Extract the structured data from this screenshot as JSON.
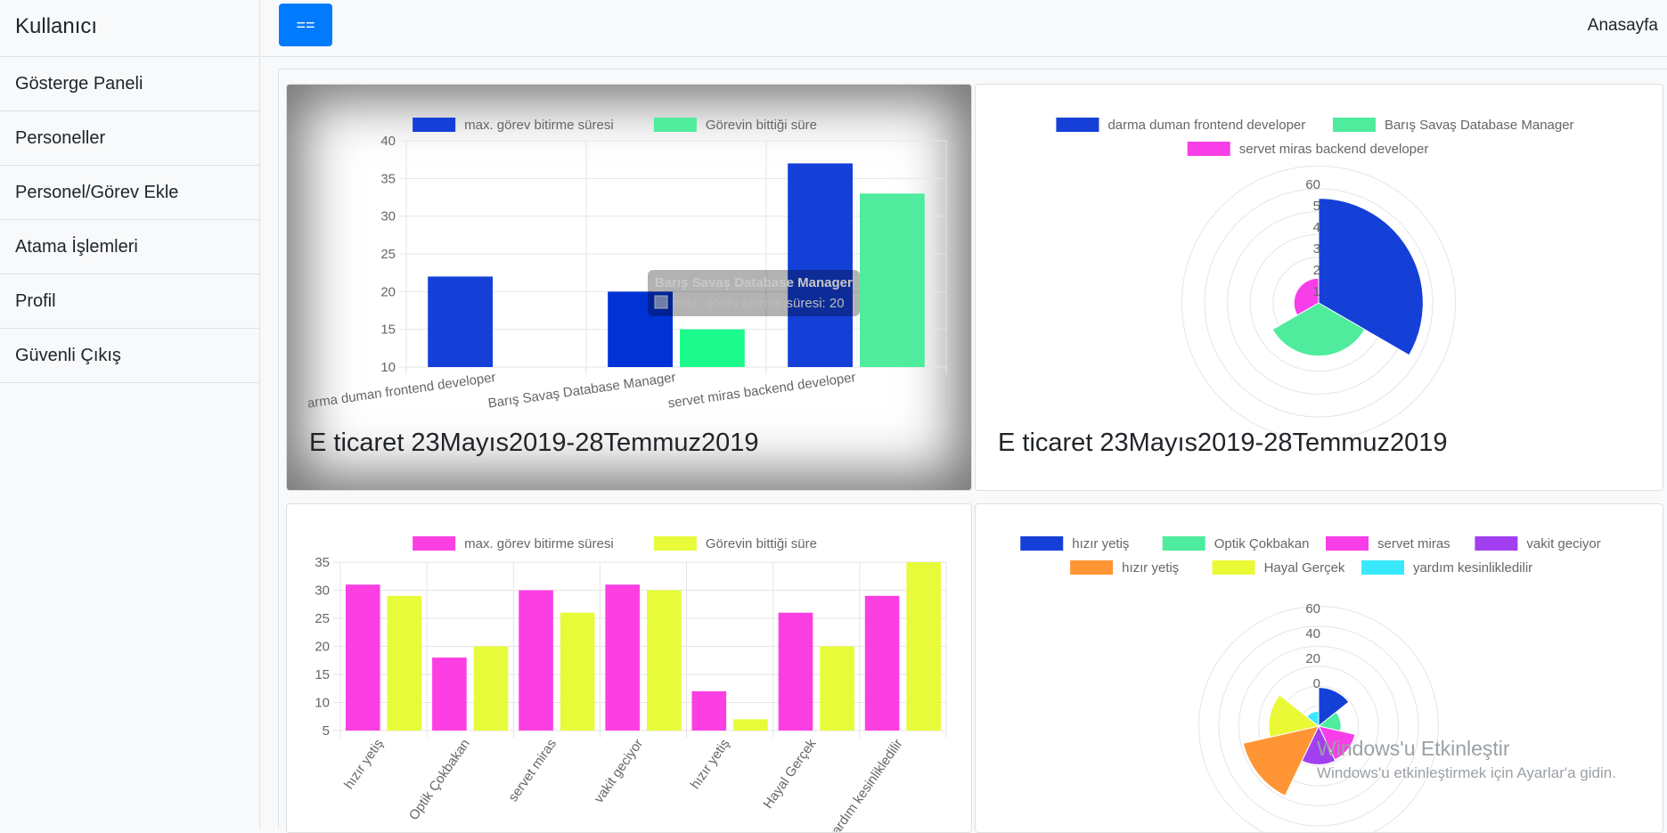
{
  "sidebar": {
    "heading": "Kullanıcı",
    "items": [
      {
        "label": "Gösterge Paneli"
      },
      {
        "label": "Personeller"
      },
      {
        "label": "Personel/Görev Ekle"
      },
      {
        "label": "Atama İşlemleri"
      },
      {
        "label": "Profil"
      },
      {
        "label": "Güvenli Çıkış"
      }
    ]
  },
  "topbar": {
    "toggle_label": "==",
    "home_label": "Anasayfa"
  },
  "cards": [
    {
      "title": "E ticaret 23Mayıs2019-28Temmuz2019"
    },
    {
      "title": "E ticaret 23Mayıs2019-28Temmuz2019"
    }
  ],
  "chart_data": [
    {
      "type": "bar",
      "categories": [
        "arma duman frontend developer",
        "Barış Savaş Database Manager",
        "servet miras backend developer"
      ],
      "series": [
        {
          "name": "max. görev bitirme süresi",
          "values": [
            22,
            20,
            37
          ],
          "color": "#1440d8"
        },
        {
          "name": "Görevin bittiği süre",
          "values": [
            10,
            15,
            33
          ],
          "color": "#4eec9c"
        }
      ],
      "ylim": [
        10,
        40
      ],
      "yticks": [
        10,
        15,
        20,
        25,
        30,
        35,
        40
      ],
      "grid": true,
      "legend": "top",
      "tooltip": {
        "title": "Barış Savaş Database Manager",
        "text": "max. görev bitirme süresi: 20"
      }
    },
    {
      "type": "polarArea",
      "labels": [
        "darma duman frontend developer",
        "Barış Savaş Database Manager",
        "servet miras backend developer"
      ],
      "values": [
        55,
        28,
        13
      ],
      "colors": [
        "#1440d8",
        "#4eec9c",
        "#f73ee8"
      ],
      "rmax": 60,
      "ticks": [
        "60",
        "5",
        "4",
        "3",
        "2",
        "1"
      ],
      "legend": "top"
    },
    {
      "type": "bar",
      "categories": [
        "hızır yetiş",
        "Optik Çokbakan",
        "servet miras",
        "vakit geciyor",
        "hızır yetiş",
        "Hayal Gerçek",
        "yardım kesinlikledilir"
      ],
      "series": [
        {
          "name": "max. görev bitirme süresi",
          "values": [
            31,
            18,
            30,
            31,
            12,
            26,
            29
          ],
          "color": "#fb3fe3"
        },
        {
          "name": "Görevin bittiği süre",
          "values": [
            29,
            20,
            26,
            30,
            7,
            20,
            35
          ],
          "color": "#e8fb3a"
        }
      ],
      "ylim": [
        5,
        35
      ],
      "yticks": [
        5,
        10,
        15,
        20,
        25,
        30,
        35
      ],
      "grid": true,
      "legend": "top"
    },
    {
      "type": "polarArea",
      "labels": [
        "hızır yetiş",
        "Optik Çokbakan",
        "servet miras",
        "vakit geciyor",
        "hızır yetiş",
        "Hayal Gerçek",
        "yardım kesinlikledilir"
      ],
      "values": [
        31,
        18,
        30,
        31,
        62,
        40,
        12
      ],
      "colors": [
        "#1440d8",
        "#4eec9c",
        "#f73ee8",
        "#a23ff0",
        "#ff9534",
        "#e9f935",
        "#38e9fb"
      ],
      "rmax": 80,
      "ticks": [
        "60",
        "40",
        "20",
        "0"
      ],
      "legend": "top"
    }
  ],
  "watermark": {
    "title": "Windows'u Etkinleştir",
    "subtitle": "Windows'u etkinleştirmek için Ayarlar'a gidin."
  }
}
